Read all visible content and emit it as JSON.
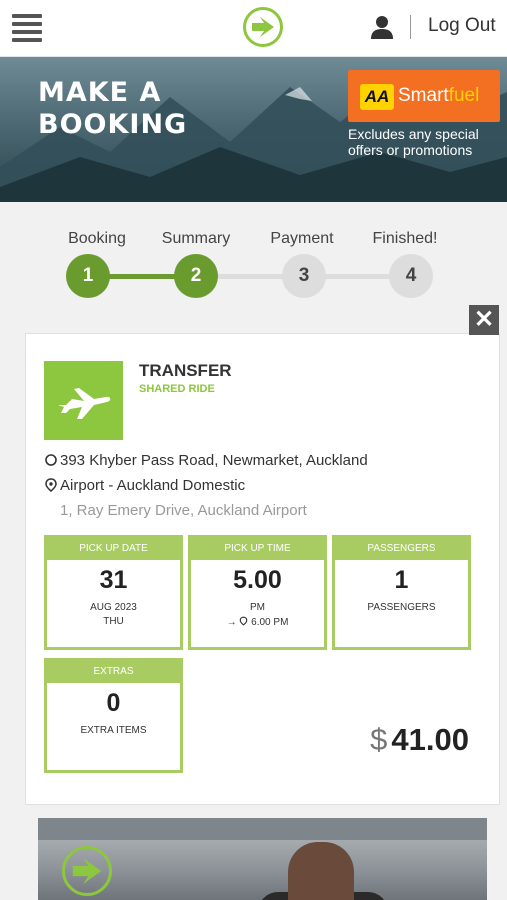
{
  "header": {
    "logout_label": "Log Out",
    "brand_color": "#8dc63f"
  },
  "hero": {
    "title": "MAKE A BOOKING",
    "badge": {
      "aa": "AA",
      "smart": "Smart",
      "fuel": "fuel",
      "note": "Excludes any special offers or promotions"
    }
  },
  "steps": [
    {
      "label": "Booking",
      "number": "1",
      "state": "done"
    },
    {
      "label": "Summary",
      "number": "2",
      "state": "current"
    },
    {
      "label": "Payment",
      "number": "3",
      "state": "todo"
    },
    {
      "label": "Finished!",
      "number": "4",
      "state": "todo"
    }
  ],
  "booking": {
    "close_glyph": "✕",
    "type_title": "TRANSFER",
    "type_subtitle": "SHARED RIDE",
    "from_address": "393 Khyber Pass Road, Newmarket, Auckland",
    "to_name": "Airport - Auckland Domestic",
    "to_detail": "1, Ray Emery Drive, Auckland Airport",
    "tiles": {
      "pickup_date": {
        "head": "PICK UP DATE",
        "big": "31",
        "line1": "AUG 2023",
        "line2": "THU"
      },
      "pickup_time": {
        "head": "PICK UP TIME",
        "big": "5.00",
        "line1": "PM",
        "line2": "6.00 PM"
      },
      "passengers": {
        "head": "PASSENGERS",
        "big": "1",
        "line1": "PASSENGERS"
      },
      "extras": {
        "head": "EXTRAS",
        "big": "0",
        "line1": "EXTRA ITEMS"
      }
    },
    "currency": "$",
    "price": "41.00"
  }
}
